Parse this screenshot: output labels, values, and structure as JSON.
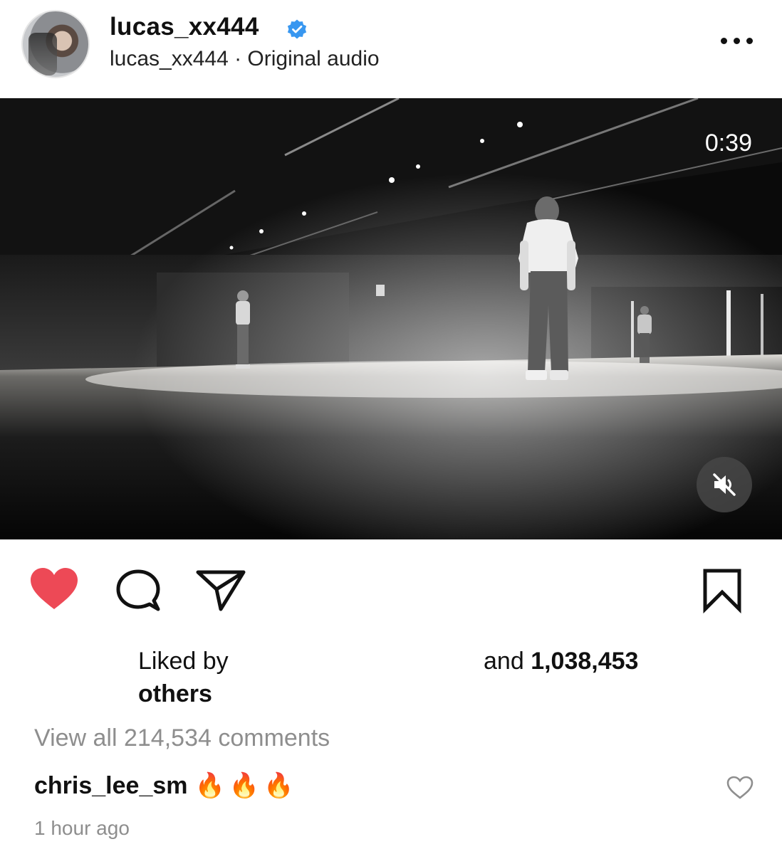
{
  "header": {
    "username": "lucas_xx444",
    "subline": "lucas_xx444 · Original audio",
    "verified": true
  },
  "video": {
    "duration": "0:39",
    "muted": true
  },
  "actions": {
    "liked": true,
    "like_color": "#ed4956"
  },
  "likes": {
    "line1": "Liked by",
    "line2": "others",
    "prefix": "and",
    "count": "1,038,453"
  },
  "comments": {
    "view_all": "View all 214,534 comments",
    "top": {
      "user": "chris_lee_sm",
      "text": "🔥🔥🔥"
    },
    "time": "1 hour ago"
  }
}
